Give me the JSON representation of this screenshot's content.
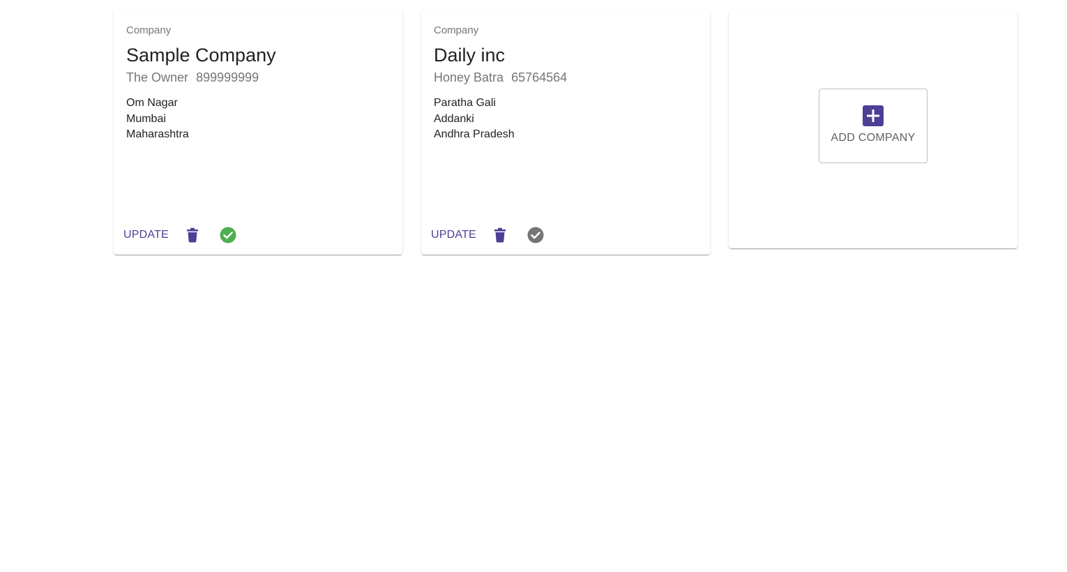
{
  "colors": {
    "accent": "#4e3e96",
    "active_check": "#4caf50",
    "inactive_check": "#757575",
    "secondary_text": "#757575",
    "primary_text": "#212121"
  },
  "companies": [
    {
      "overline": "Company",
      "name": "Sample Company",
      "owner": "The Owner",
      "phone": "899999999",
      "address": [
        "Om Nagar",
        "Mumbai",
        "Maharashtra"
      ],
      "update_label": "UPDATE",
      "delete_icon": "trash-icon",
      "status_icon": "check-circle-icon",
      "active": true
    },
    {
      "overline": "Company",
      "name": "Daily inc",
      "owner": "Honey Batra",
      "phone": "65764564",
      "address": [
        "Paratha Gali",
        "Addanki",
        "Andhra Pradesh"
      ],
      "update_label": "UPDATE",
      "delete_icon": "trash-icon",
      "status_icon": "check-circle-icon",
      "active": false
    }
  ],
  "add_company": {
    "label": "ADD COMPANY",
    "icon": "plus-box-icon"
  }
}
